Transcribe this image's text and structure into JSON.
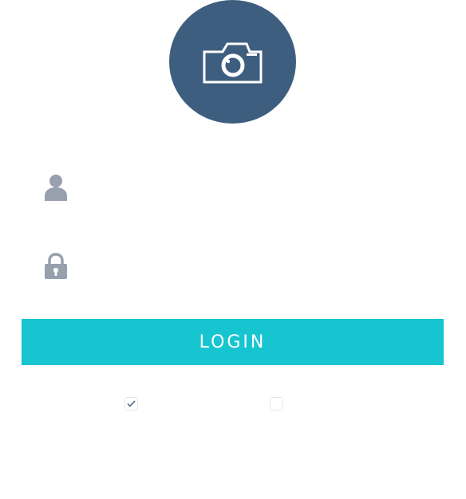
{
  "avatar": {
    "icon": "camera-icon",
    "color": "#3e5e7f"
  },
  "username": {
    "icon": "user-icon",
    "value": "",
    "placeholder": ""
  },
  "password": {
    "icon": "lock-icon",
    "value": "",
    "placeholder": ""
  },
  "login": {
    "label": "LOGIN",
    "color": "#17c5d1"
  },
  "options": [
    {
      "checked": true,
      "icon": "check-icon"
    },
    {
      "checked": false
    }
  ]
}
